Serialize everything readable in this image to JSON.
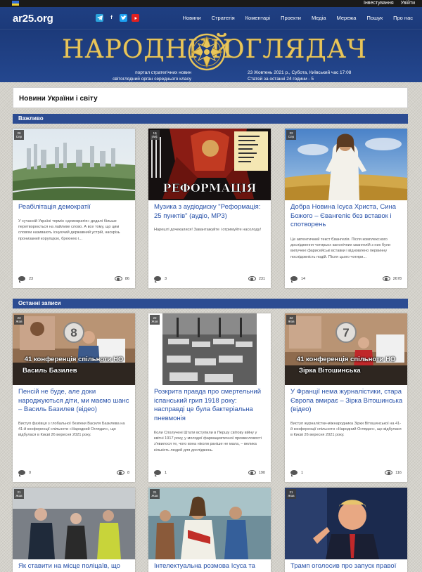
{
  "topbar": {
    "links": [
      "Інвестування",
      "Увійти"
    ]
  },
  "header": {
    "site": "ar25.org",
    "social": [
      "telegram",
      "facebook",
      "twitter",
      "youtube"
    ],
    "menu": [
      "Новини",
      "Стратегія",
      "Коментарі",
      "Проекти",
      "Медіа",
      "Мережа",
      "Пошук",
      "Про нас"
    ],
    "brand_left": "НАРОДНИЙ",
    "brand_right": "ОГЛЯДАЧ",
    "tagline_1": "портал стратегічних новин",
    "tagline_2": "світоглядний орган середнього класу",
    "date_line": "23 Жовтень 2021 р., Субота, Київський час 17:08",
    "stats_line": "Статей за останні 24 години - 5"
  },
  "page_title": "Новини України і світу",
  "sections": {
    "important": "Важливо",
    "latest": "Останні записи"
  },
  "important": [
    {
      "day": "26",
      "month": "Сер",
      "title": "Реабілітація демократії",
      "excerpt": "У сучасній Україні термін «демократія» дедалі більше перетворюється на лайливе слово. А все тому, що цим словом називають існуючий державний устрій, наскрізь пронизаний корупцією, брехнею і...",
      "comments": "23",
      "views": "86"
    },
    {
      "day": "13",
      "month": "Лис",
      "title": "Музика з аудіодиску \"Реформація: 25 пунктів\" (аудіо, МР3)",
      "excerpt": "Нарешті дочекалися! Завантажуйте і отримуйте насолоду!",
      "comments": "3",
      "views": "231"
    },
    {
      "day": "22",
      "month": "Сер",
      "title": "Добра Новина Ісуса Христа, Сина Божого – Євангеліє без вставок і спотворень",
      "excerpt": "Це автентичний текст Євангелія. Після комплексного дослідження чотирьох канонічних євангелій з них були вилучені фарисейські вставки і відновлено первинну послідовність подій. Після цього чотири...",
      "comments": "14",
      "views": "2678"
    }
  ],
  "latest": [
    {
      "day": "23",
      "month": "Жов",
      "title": "Пенсій не буде, але доки народжуються діти, ми маємо шанс – Василь Базилев (відео)",
      "excerpt": "Виступ фахівця з глобальної безпеки Василя Базилева на 41-й конференції спільноти «Народний Оглядач», що відбулася в Києві 26 вересня 2021 року.",
      "comments": "0",
      "views": "8",
      "overlay_num": "8",
      "overlay_conf": "41 конференція спільноти НО",
      "overlay_name": "Василь Базилев"
    },
    {
      "day": "22",
      "month": "Жов",
      "title": "Розкрита правда про смертельний іспанський грип 1918 року: насправді це була бактеріальна пневмонія",
      "excerpt": "Коли Сполучені Штати вступили в Першу світову війну у квітні 1917 року, у молодої фармацевтичної промисловості з'явилося те, чого вона ніколи раніше не мала, – велика кількість людей для досліджень.",
      "comments": "1",
      "views": "190"
    },
    {
      "day": "22",
      "month": "Жов",
      "title": "У Франції нема журналістики, стара Європа вмирає – Зірка Вітошинська (відео)",
      "excerpt": "Виступ журналістки-міжнародника Зірки Вітошинської на 41-й конференції спільноти «Народний Оглядач», що відбулася в Києві 26 вересня 2021 року.",
      "comments": "1",
      "views": "116",
      "overlay_num": "7",
      "overlay_conf": "41 конференція спільноти НО",
      "overlay_name": "Зірка Вітошинська"
    },
    {
      "day": "21",
      "month": "Жов",
      "title": "Як ставити на місце поліцаїв, що"
    },
    {
      "day": "21",
      "month": "Жов",
      "title": "Інтелектуальна розмова Ісуса та"
    },
    {
      "day": "21",
      "month": "Жов",
      "title": "Трамп оголосив про запуск правої"
    }
  ]
}
